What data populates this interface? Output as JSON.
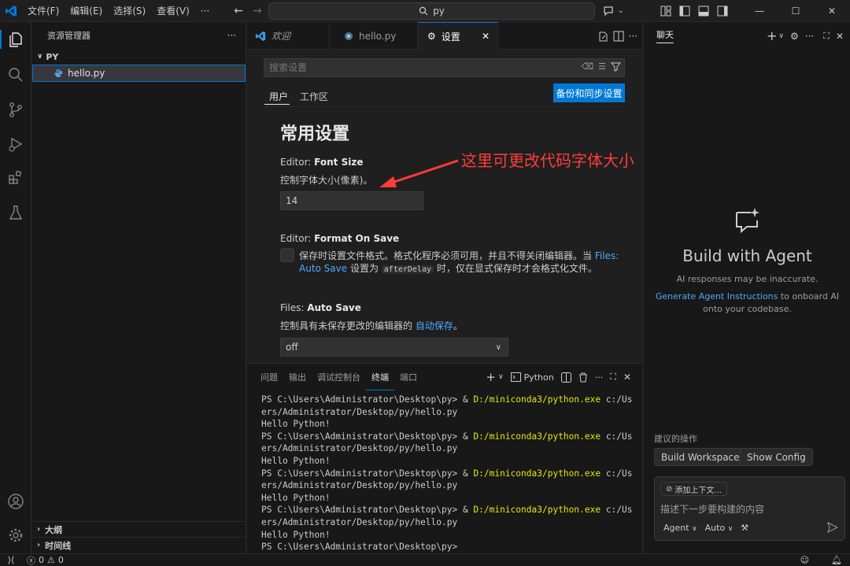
{
  "titlebar": {
    "menus": [
      "文件(F)",
      "编辑(E)",
      "选择(S)",
      "查看(V)",
      "···"
    ],
    "search": "py"
  },
  "sidebar": {
    "title": "资源管理器",
    "folder": "PY",
    "file": "hello.py",
    "bottom": [
      "大纲",
      "时间线"
    ]
  },
  "editor": {
    "tabs": [
      {
        "label": "欢迎",
        "icon": "vscode-icon"
      },
      {
        "label": "hello.py",
        "icon": "python-icon"
      },
      {
        "label": "设置",
        "icon": "settings-icon"
      }
    ],
    "settings": {
      "search_placeholder": "搜索设置",
      "scopes": [
        "用户",
        "工作区"
      ],
      "backup_button": "备份和同步设置",
      "heading": "常用设置",
      "font_size": {
        "prefix": "Editor: ",
        "title": "Font Size",
        "desc": "控制字体大小(像素)。",
        "value": "14"
      },
      "format_on_save": {
        "prefix": "Editor: ",
        "title": "Format On Save",
        "desc_1": "保存时设置文件格式。格式化程序必须可用，并且不得关闭编辑器。当 ",
        "link_1": "Files:",
        "link_2": "Auto Save",
        "desc_2": " 设置为 ",
        "code": "afterDelay",
        "desc_3": " 时，仅在显式保存时才会格式化文件。"
      },
      "auto_save": {
        "prefix": "Files: ",
        "title": "Auto Save",
        "desc_1": "控制具有未保存更改的编辑器的 ",
        "link": "自动保存",
        "desc_2": "。",
        "value": "off"
      }
    },
    "annotation": "这里可更改代码字体大小"
  },
  "panel": {
    "tabs": [
      "问题",
      "输出",
      "调试控制台",
      "终端",
      "端口"
    ],
    "active_tab": "终端",
    "shell": "Python",
    "terminal_lines": [
      {
        "p": "PS C:\\Users\\Administrator\\Desktop\\py> & ",
        "y": "D:/miniconda3/python.exe",
        "s": " c:/Us"
      },
      {
        "p": "ers/Administrator/Desktop/py/hello.py",
        "y": "",
        "s": ""
      },
      {
        "p": "Hello Python!",
        "y": "",
        "s": ""
      },
      {
        "p": "PS C:\\Users\\Administrator\\Desktop\\py> & ",
        "y": "D:/miniconda3/python.exe",
        "s": " c:/Us"
      },
      {
        "p": "ers/Administrator/Desktop/py/hello.py",
        "y": "",
        "s": ""
      },
      {
        "p": "Hello Python!",
        "y": "",
        "s": ""
      },
      {
        "p": "PS C:\\Users\\Administrator\\Desktop\\py> & ",
        "y": "D:/miniconda3/python.exe",
        "s": " c:/Us"
      },
      {
        "p": "ers/Administrator/Desktop/py/hello.py",
        "y": "",
        "s": ""
      },
      {
        "p": "Hello Python!",
        "y": "",
        "s": ""
      },
      {
        "p": "PS C:\\Users\\Administrator\\Desktop\\py> & ",
        "y": "D:/miniconda3/python.exe",
        "s": " c:/Us"
      },
      {
        "p": "ers/Administrator/Desktop/py/hello.py",
        "y": "",
        "s": ""
      },
      {
        "p": "Hello Python!",
        "y": "",
        "s": ""
      },
      {
        "p": "PS C:\\Users\\Administrator\\Desktop\\py>",
        "y": "",
        "s": ""
      }
    ]
  },
  "chat": {
    "tab": "聊天",
    "title": "Build with Agent",
    "subtitle": "AI responses may be inaccurate.",
    "link": "Generate Agent Instructions",
    "desc": " to onboard AI onto your codebase.",
    "suggest_label": "建议的操作",
    "suggestions": [
      "Build Workspace",
      "Show Config"
    ],
    "add_context": "添加上下文...",
    "placeholder": "描述下一步要构建的内容",
    "mode": "Agent",
    "model": "Auto"
  },
  "statusbar": {
    "errors": "0",
    "warnings": "0"
  },
  "colors": {
    "accent": "#0078d4",
    "annotation": "#ff3b3b",
    "link": "#4daafc",
    "terminal_yellow": "#e5e510"
  }
}
